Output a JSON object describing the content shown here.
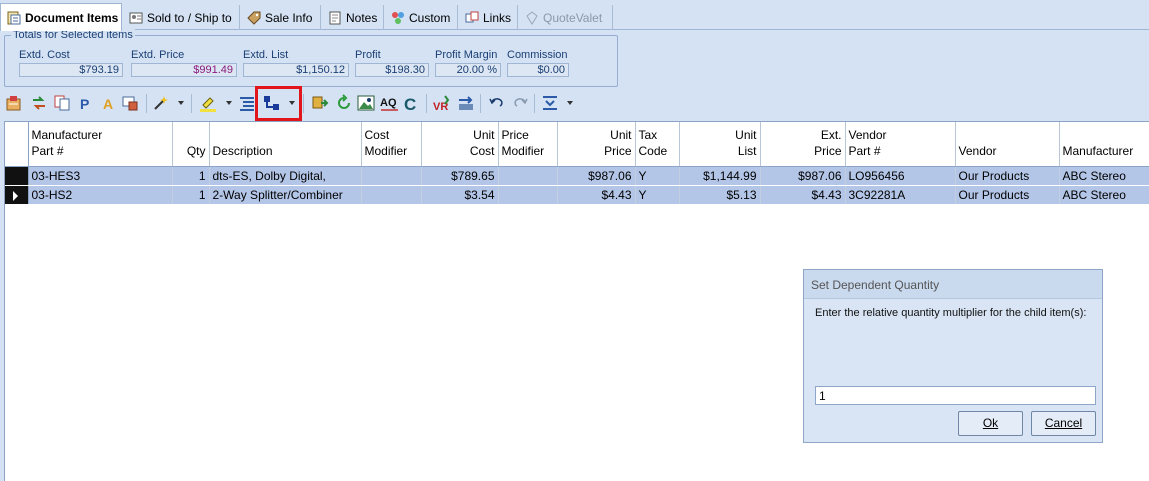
{
  "tabs": [
    {
      "label": "Document Items",
      "icon": "document-items-icon",
      "active": true
    },
    {
      "label": "Sold to / Ship to",
      "icon": "contact-card-icon"
    },
    {
      "label": "Sale Info",
      "icon": "tag-icon"
    },
    {
      "label": "Notes",
      "icon": "notes-icon"
    },
    {
      "label": "Custom",
      "icon": "custom-icon"
    },
    {
      "label": "Links",
      "icon": "links-icon"
    },
    {
      "label": "QuoteValet",
      "icon": "quotevalet-icon",
      "disabled": true
    }
  ],
  "totals": {
    "legend": "Totals for Selected items",
    "fields": [
      {
        "label": "Extd. Cost",
        "value": "$793.19"
      },
      {
        "label": "Extd. Price",
        "value": "$991.49",
        "color": "#8a1a7a"
      },
      {
        "label": "Extd. List",
        "value": "$1,150.12"
      },
      {
        "label": "Profit",
        "value": "$198.30"
      },
      {
        "label": "Profit Margin",
        "value": "20.00 %"
      },
      {
        "label": "Commission",
        "value": "$0.00"
      }
    ]
  },
  "toolbar": {
    "icons": [
      "add-items-icon",
      "swap-icon",
      "copy-icon",
      "p-icon",
      "a-icon",
      "tag-filter-icon",
      "magic-wand-icon",
      "highlight-icon",
      "indent-list-icon",
      "set-dependent-icon",
      "insert-icon",
      "refresh-icon",
      "image-icon",
      "spellcheck-icon",
      "c-icon",
      "vr-icon",
      "transfer-icon",
      "undo-icon",
      "redo-icon",
      "collapse-icon"
    ],
    "aq_label": "AQ",
    "c_label": "C",
    "p_label": "P",
    "a_label": "A"
  },
  "grid": {
    "columns": [
      {
        "label": "Manufacturer\nPart #",
        "align": "l"
      },
      {
        "label": "Qty",
        "align": "r"
      },
      {
        "label": "Description",
        "align": "l"
      },
      {
        "label": "Cost\nModifier",
        "align": "l"
      },
      {
        "label": "Unit\nCost",
        "align": "r"
      },
      {
        "label": "Price\nModifier",
        "align": "l"
      },
      {
        "label": "Unit\nPrice",
        "align": "r"
      },
      {
        "label": "Tax\nCode",
        "align": "l"
      },
      {
        "label": "Unit\nList",
        "align": "r"
      },
      {
        "label": "Ext.\nPrice",
        "align": "r"
      },
      {
        "label": "Vendor\nPart #",
        "align": "l"
      },
      {
        "label": "Vendor",
        "align": "l"
      },
      {
        "label": "Manufacturer",
        "align": "l"
      }
    ],
    "rows": [
      [
        "03-HES3",
        "1",
        "dts-ES, Dolby Digital,",
        "",
        "$789.65",
        "",
        "$987.06",
        "Y",
        "$1,144.99",
        "$987.06",
        "LO956456",
        "Our Products",
        "ABC Stereo"
      ],
      [
        "03-HS2",
        "1",
        "2-Way Splitter/Combiner",
        "",
        "$3.54",
        "",
        "$4.43",
        "Y",
        "$5.13",
        "$4.43",
        "3C92281A",
        "Our Products",
        "ABC Stereo"
      ]
    ]
  },
  "dialog": {
    "title": "Set Dependent Quantity",
    "message": "Enter the relative quantity multiplier for the child item(s):",
    "input_value": "1",
    "ok_label": "Ok",
    "cancel_label": "Cancel"
  }
}
